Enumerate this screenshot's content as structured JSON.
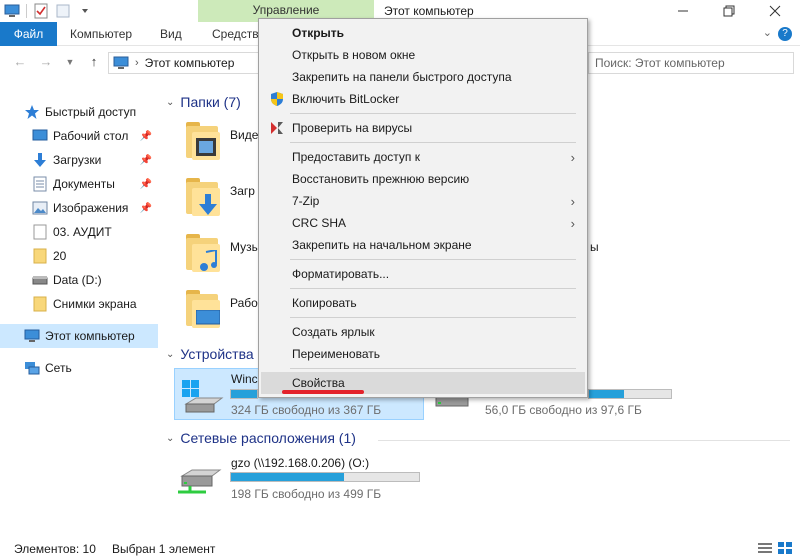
{
  "window": {
    "title": "Этот компьютер",
    "manage_tab": "Управление"
  },
  "ribbon": {
    "tabs": [
      "Файл",
      "Компьютер",
      "Вид",
      "Средства"
    ]
  },
  "navbar": {
    "address_text": "Этот компьютер",
    "search_placeholder": "Поиск: Этот компьютер"
  },
  "sidebar": {
    "items": [
      {
        "label": "Быстрый доступ",
        "icon": "star-icon"
      },
      {
        "label": "Рабочий стол",
        "icon": "desktop-icon"
      },
      {
        "label": "Загрузки",
        "icon": "download-icon"
      },
      {
        "label": "Документы",
        "icon": "documents-icon"
      },
      {
        "label": "Изображения",
        "icon": "images-icon"
      },
      {
        "label": "03. АУДИТ",
        "icon": "file-icon"
      },
      {
        "label": "20",
        "icon": "folder-icon"
      },
      {
        "label": "Data (D:)",
        "icon": "drive-icon"
      },
      {
        "label": "Снимки экрана",
        "icon": "folder-icon"
      },
      {
        "label": "Этот компьютер",
        "icon": "computer-icon"
      },
      {
        "label": "Сеть",
        "icon": "network-icon"
      }
    ]
  },
  "main": {
    "folders_header": "Папки (7)",
    "folders": [
      {
        "label": "Виде"
      },
      {
        "label": "Загр"
      },
      {
        "label": "Музы"
      },
      {
        "label": "Рабо"
      }
    ],
    "tail_text": "ы",
    "devices_header": "Устройства",
    "drives": [
      {
        "name": "Winc",
        "free": "324 ГБ свободно из 367 ГБ",
        "used_fraction": 0.12
      },
      {
        "name": "",
        "free": "56,0 ГБ свободно из 97,6 ГБ",
        "used_fraction": 0.43
      }
    ],
    "network_header": "Сетевые расположения (1)",
    "network": [
      {
        "name": "gzo (\\\\192.168.0.206) (O:)",
        "free": "198 ГБ свободно из 499 ГБ",
        "used_fraction": 0.6
      }
    ]
  },
  "status": {
    "count": "Элементов: 10",
    "selected": "Выбран 1 элемент"
  },
  "context_menu": {
    "items": [
      {
        "label": "Открыть",
        "bold": true
      },
      {
        "label": "Открыть в новом окне"
      },
      {
        "label": "Закрепить на панели быстрого доступа"
      },
      {
        "label": "Включить BitLocker",
        "icon": "shield-icon"
      },
      {
        "label": "Проверить на вирусы",
        "icon": "antivirus-icon"
      },
      {
        "label": "Предоставить доступ к",
        "submenu": true
      },
      {
        "label": "Восстановить прежнюю версию"
      },
      {
        "label": "7-Zip",
        "submenu": true
      },
      {
        "label": "CRC SHA",
        "submenu": true
      },
      {
        "label": "Закрепить на начальном экране"
      },
      {
        "label": "Форматировать..."
      },
      {
        "label": "Копировать"
      },
      {
        "label": "Создать ярлык"
      },
      {
        "label": "Переименовать"
      },
      {
        "label": "Свойства",
        "highlighted": true
      }
    ]
  },
  "colors": {
    "accent": "#1979ca",
    "selection": "#cce8ff",
    "manage_tab": "#cdeaba",
    "progress": "#26a0da",
    "annotation": "#e3222b"
  }
}
